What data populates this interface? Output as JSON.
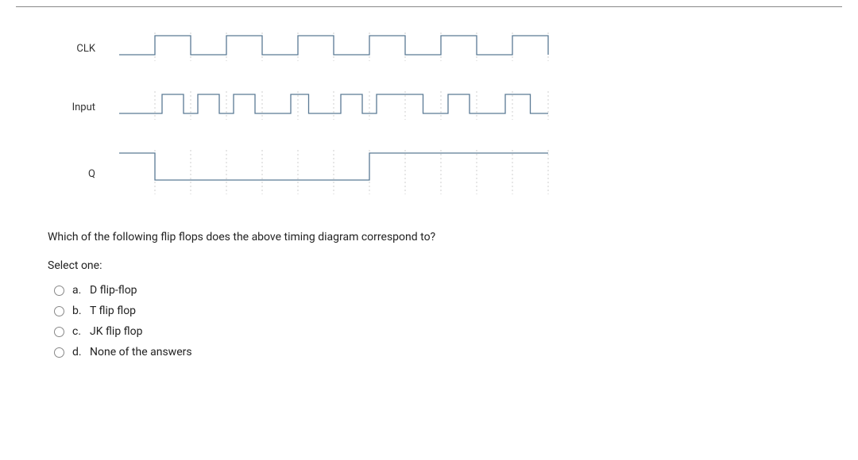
{
  "signals": {
    "clk": {
      "label": "CLK"
    },
    "input": {
      "label": "Input"
    },
    "q": {
      "label": "Q"
    }
  },
  "question": "Which of the following flip flops does the above timing diagram correspond to?",
  "select_prompt": "Select one:",
  "options": [
    {
      "letter": "a.",
      "text": "D flip-flop"
    },
    {
      "letter": "b.",
      "text": "T flip flop"
    },
    {
      "letter": "c.",
      "text": "JK flip flop"
    },
    {
      "letter": "d.",
      "text": "None of the answers"
    }
  ],
  "chart_data": {
    "type": "timing-diagram",
    "time_range": [
      0,
      12
    ],
    "clock_edges": [
      1,
      2,
      3,
      4,
      5,
      6,
      7,
      8,
      9,
      10,
      11,
      12
    ],
    "signals": [
      {
        "name": "CLK",
        "transitions": [
          {
            "t": 0,
            "v": 0
          },
          {
            "t": 1,
            "v": 1
          },
          {
            "t": 2,
            "v": 0
          },
          {
            "t": 3,
            "v": 1
          },
          {
            "t": 4,
            "v": 0
          },
          {
            "t": 5,
            "v": 1
          },
          {
            "t": 6,
            "v": 0
          },
          {
            "t": 7,
            "v": 1
          },
          {
            "t": 8,
            "v": 0
          },
          {
            "t": 9,
            "v": 1
          },
          {
            "t": 10,
            "v": 0
          },
          {
            "t": 11,
            "v": 1
          },
          {
            "t": 12,
            "v": 0
          }
        ]
      },
      {
        "name": "Input",
        "transitions": [
          {
            "t": 0,
            "v": 0
          },
          {
            "t": 1.2,
            "v": 1
          },
          {
            "t": 1.8,
            "v": 0
          },
          {
            "t": 2.2,
            "v": 1
          },
          {
            "t": 2.8,
            "v": 0
          },
          {
            "t": 3.2,
            "v": 1
          },
          {
            "t": 3.8,
            "v": 0
          },
          {
            "t": 4.8,
            "v": 1
          },
          {
            "t": 5.3,
            "v": 0
          },
          {
            "t": 6.2,
            "v": 1
          },
          {
            "t": 6.8,
            "v": 0
          },
          {
            "t": 7.2,
            "v": 1
          },
          {
            "t": 8.5,
            "v": 0
          },
          {
            "t": 9.2,
            "v": 1
          },
          {
            "t": 9.8,
            "v": 0
          },
          {
            "t": 10.8,
            "v": 1
          },
          {
            "t": 11.5,
            "v": 0
          }
        ]
      },
      {
        "name": "Q",
        "transitions": [
          {
            "t": 0,
            "v": 1
          },
          {
            "t": 1,
            "v": 0
          },
          {
            "t": 7,
            "v": 1
          }
        ]
      }
    ]
  }
}
